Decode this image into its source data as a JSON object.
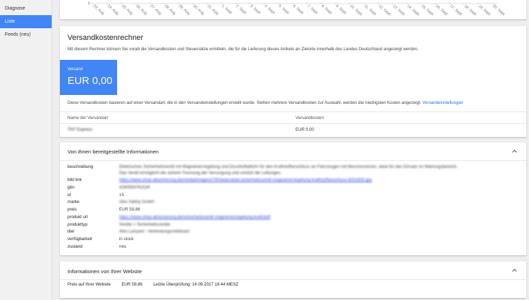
{
  "sidebar": {
    "items": [
      {
        "label": "Diagnose",
        "active": false
      },
      {
        "label": "Liste",
        "active": true
      },
      {
        "label": "Feeds (neu)",
        "active": false
      }
    ]
  },
  "timeline": {
    "zero_label": "0",
    "dates": [
      "23. Aug.",
      "24. Aug.",
      "25. Aug.",
      "26. Aug.",
      "27. Aug.",
      "28. Aug.",
      "29. Aug.",
      "30. Aug.",
      "31. Aug.",
      "1. Sept.",
      "2. Sept.",
      "3. Sept.",
      "4. Sept.",
      "5. Sept.",
      "6. Sept.",
      "7. Sept.",
      "8. Sept.",
      "9. Sept.",
      "10. Sept.",
      "11. Sept.",
      "12. Sept.",
      "13. Sept.",
      "14. Sept.",
      "15. Sept.",
      "16. Sept.",
      "17. Sept.",
      "18. Sept.",
      "19. Sept.",
      "20. Sept."
    ]
  },
  "rechner": {
    "title": "Versandkostenrechner",
    "intro": "Mit diesem Rechner können Sie vorab die Versandkosten und Steuersätze ermitteln, die für die Lieferung dieses Artikels an Zielorte innerhalb des Landes Deutschland angezeigt werden.",
    "box_label": "Versand",
    "box_amount": "EUR 0,00",
    "note": "Diese Versandkosten basieren auf einer Versandart, die in den Versandeinstellungen erstellt wurde. Stehen mehrere Versandkosten zur Auswahl, werden die niedrigsten Kosten angezeigt.",
    "note_link": "Versandeinstellungen",
    "col_name": "Name der Versandart",
    "col_cost": "Versandkosten",
    "row_name": "TNT Express",
    "row_cost": "EUR 0,00"
  },
  "info": {
    "title": "Von Ihnen bereitgestellte Informationen",
    "rows": [
      {
        "key": "beschreibung",
        "value": "Elektrisches Sicherheitsventil mit Magnetverriegelung und Druckluftabfuhr für den Kraftstoffanschluss an Fahrzeugen mit Benzinmotoren, ideal für den Einsatz im Wartungsbereich.",
        "value2": "Das Ventil ermöglicht die sichere Trennung der Versorgung und schützt die Leitungen.",
        "blur": true,
        "link": false
      },
      {
        "key": "bild link",
        "value": "https://www.shop-absicherung.de/media/image/a7/0f/4a/produkt-sicherheitsventil-magnetverriegelung-kraftstoffanschluss-600x600.jpg",
        "blur": true,
        "link": true
      },
      {
        "key": "gtin",
        "value": "4260584761530",
        "blur": true,
        "link": false
      },
      {
        "key": "id",
        "value": "15",
        "blur": false,
        "link": false
      },
      {
        "key": "marke",
        "value": "Abis Safety GmbH",
        "blur": true,
        "link": false
      },
      {
        "key": "preis",
        "value": "EUR 59,86",
        "blur": false,
        "link": false
      },
      {
        "key": "produkt url",
        "value": "https://www.shop-absicherung.de/sicherheitsventil-magnetverriegelung-kraftstoff",
        "blur": true,
        "link": true
      },
      {
        "key": "produkttyp",
        "value": "Ventile > Sicherheitsventile",
        "blur": true,
        "link": false
      },
      {
        "key": "titel",
        "value": "Abis Lanyard - Verbindungsmittelsatz",
        "blur": true,
        "link": false
      },
      {
        "key": "verfügbarkeit",
        "value": "in stock",
        "blur": false,
        "link": false
      },
      {
        "key": "zustand",
        "value": "neu",
        "blur": false,
        "link": false
      }
    ]
  },
  "website": {
    "title": "Informationen von Ihrer Website",
    "price_label": "Preis auf Ihrer Website",
    "price_value": "EUR 59,86",
    "last_check": "Letzte Überprüfung: 14.09.2017 18:44 MESZ"
  },
  "colors": {
    "accent": "#4285f4",
    "link": "#1a73e8",
    "background": "#eeeeee"
  }
}
